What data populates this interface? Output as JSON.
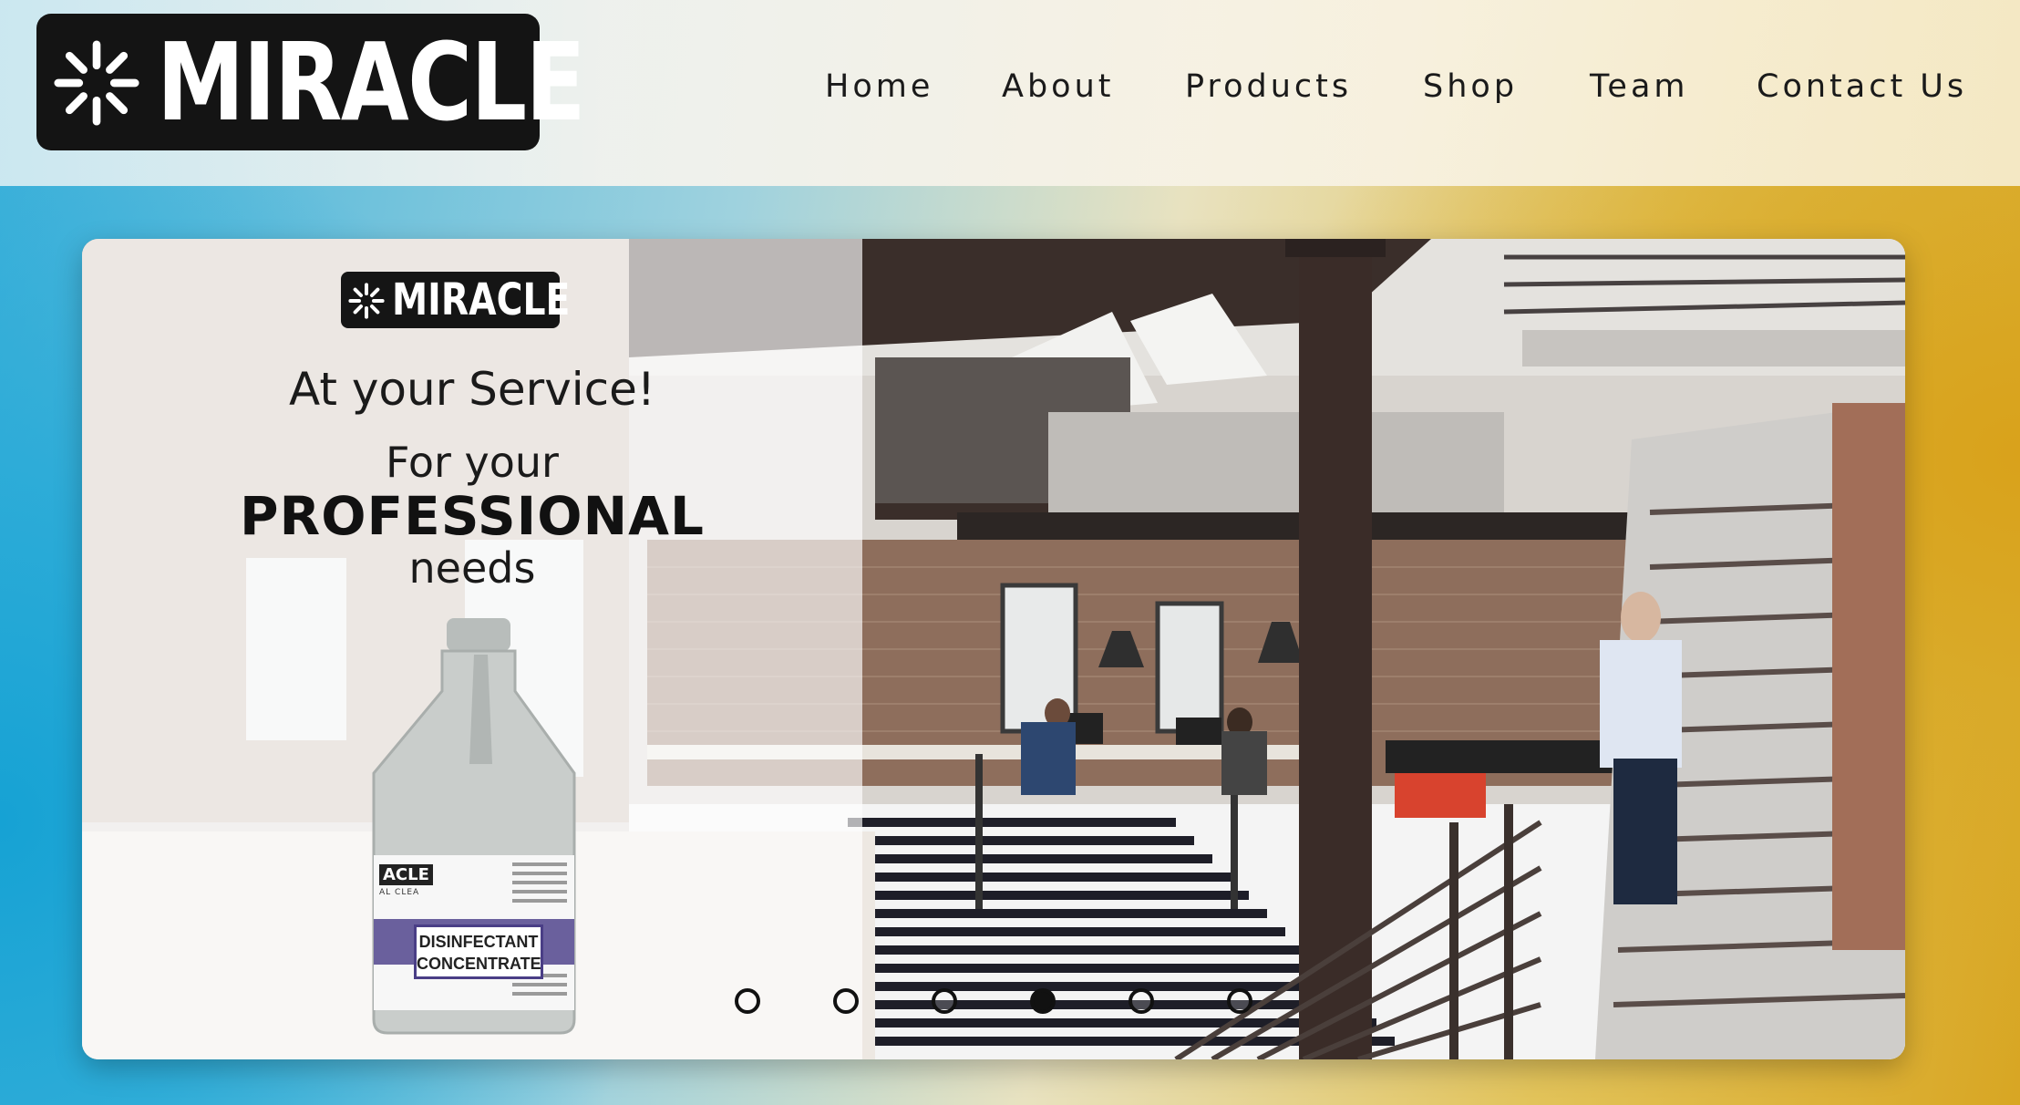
{
  "header": {
    "logo_text": "MIRACLE",
    "nav": [
      {
        "label": "Home"
      },
      {
        "label": "About"
      },
      {
        "label": "Products"
      },
      {
        "label": "Shop"
      },
      {
        "label": "Team"
      },
      {
        "label": "Contact Us"
      }
    ]
  },
  "hero": {
    "brand": "MIRACLE",
    "tagline": "At your Service!",
    "line1": "For your",
    "line2": "PROFESSIONAL",
    "line3": "needs",
    "product": {
      "brand": "ACLE",
      "subbrand": "AL CLEA",
      "name_line1": "DISINFECTANT",
      "name_line2": "CONCENTRATE"
    },
    "carousel": {
      "slide_count": 6,
      "active_index": 3
    }
  },
  "colors": {
    "logo_bg": "#141414",
    "nav_text": "#1a1a1a",
    "label_accent": "#4a3e86",
    "bg_blue": "#16a2d4",
    "bg_gold": "#d9a21b"
  }
}
